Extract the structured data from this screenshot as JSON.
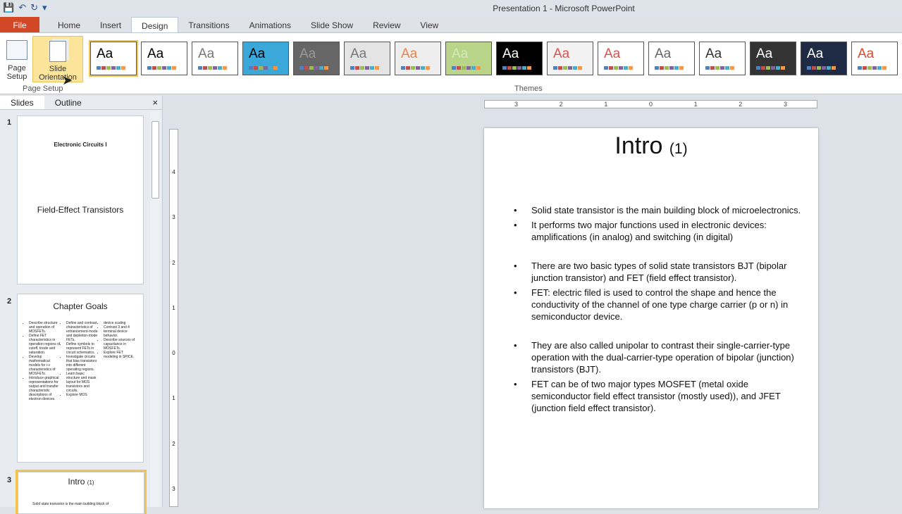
{
  "window": {
    "title": "Presentation 1 - Microsoft PowerPoint"
  },
  "qat": {
    "save": "💾",
    "undo": "↶",
    "redo": "↻",
    "more": "▾"
  },
  "tabs": [
    "File",
    "Home",
    "Insert",
    "Design",
    "Transitions",
    "Animations",
    "Slide Show",
    "Review",
    "View"
  ],
  "ribbon": {
    "page_setup": "Page Setup",
    "slide_orientation": "Slide Orientation",
    "group_page_setup": "Page Setup",
    "group_themes": "Themes",
    "theme_label": "Aa"
  },
  "themes": [
    {
      "bg": "#ffffff",
      "fg": "#000000"
    },
    {
      "bg": "#ffffff",
      "fg": "#000000"
    },
    {
      "bg": "#ffffff",
      "fg": "#777777"
    },
    {
      "bg": "#3aa8d8",
      "fg": "#000000"
    },
    {
      "bg": "#666666",
      "fg": "#999999"
    },
    {
      "bg": "#e4e4e4",
      "fg": "#777777"
    },
    {
      "bg": "#eeeeee",
      "fg": "#e8834a"
    },
    {
      "bg": "#b9d58a",
      "fg": "#d6e9b8"
    },
    {
      "bg": "#000000",
      "fg": "#ffffff"
    },
    {
      "bg": "#f2f2f2",
      "fg": "#d9534f"
    },
    {
      "bg": "#ffffff",
      "fg": "#d9534f"
    },
    {
      "bg": "#ffffff",
      "fg": "#666666"
    },
    {
      "bg": "#ffffff",
      "fg": "#333333"
    },
    {
      "bg": "#333333",
      "fg": "#ffffff"
    },
    {
      "bg": "#1f2a44",
      "fg": "#ffffff"
    },
    {
      "bg": "#ffffff",
      "fg": "#e0482c"
    }
  ],
  "panel": {
    "tabs": [
      "Slides",
      "Outline"
    ],
    "close": "×"
  },
  "slides": [
    {
      "number": "1",
      "subtitle": "Electronic Circuits I",
      "title": "Field-Effect Transistors"
    },
    {
      "number": "2",
      "title": "Chapter Goals",
      "col1": [
        "Describe structure and operation of MOSFETs.",
        "Define FET characteristics in operation regions of cutoff, triode and saturation.",
        "Develop mathematical models for i-v characteristics of MOSFETs.",
        "Introduce graphical representations for output and transfer characteristic descriptions of electron devices."
      ],
      "col2": [
        "Define and contrast characteristics of enhancement-mode and depletion-mode FETs.",
        "Define symbols to represent FETs in circuit schematics.",
        "Investigate circuits that bias transistors into different operating regions.",
        "Learn basic structure and mask layout for MOS transistors and circuits.",
        "Explore MOS"
      ],
      "col3": [
        "device scaling",
        "Contrast 3 and 4 terminal device behavior.",
        "Describe sources of capacitance in MOSFETs.",
        "Explore FET modeling in SPICE."
      ]
    },
    {
      "number": "3",
      "title": "Intro",
      "title_suffix": "(1)",
      "preview": "Solid state transistor is the main building block of"
    }
  ],
  "ruler": {
    "h": [
      "3",
      "2",
      "1",
      "0",
      "1",
      "2",
      "3"
    ],
    "v": [
      "4",
      "3",
      "2",
      "1",
      "0",
      "1",
      "2",
      "3"
    ]
  },
  "current_slide": {
    "title": "Intro",
    "title_suffix": "(1)",
    "bullets": [
      "Solid state transistor is the main building block of microelectronics.",
      "It performs two major functions used in electronic devices: amplifications (in analog) and switching (in digital)",
      "There are two basic types of solid state transistors BJT (bipolar junction transistor) and FET (field effect transistor).",
      "FET: electric filed is used to control the shape and hence the conductivity of the channel of one type charge carrier (p or n) in semiconductor device.",
      "They are also called unipolar to contrast their single-carrier-type operation with the dual-carrier-type operation of bipolar (junction) transistors (BJT).",
      "FET can be of two major types MOSFET (metal oxide semiconductor field effect transistor (mostly used)), and JFET (junction field effect transistor)."
    ]
  }
}
